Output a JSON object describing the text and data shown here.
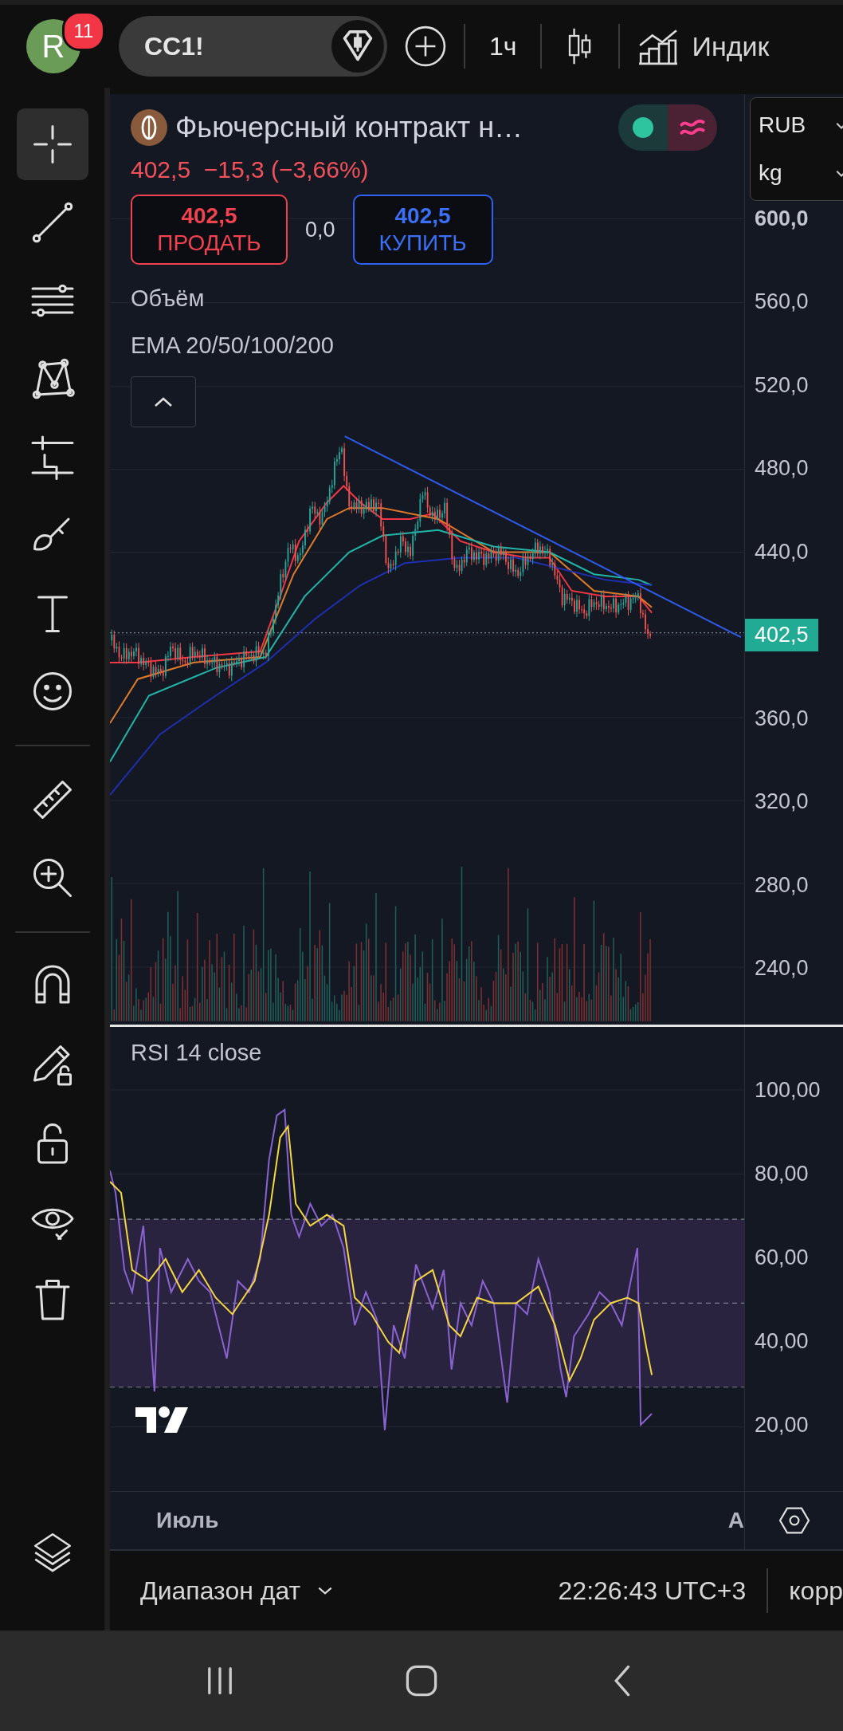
{
  "top_bar": {
    "avatar_letter": "R",
    "notification_count": "11",
    "symbol": "CC1!",
    "interval": "1ч",
    "indicators_label": "Индик"
  },
  "tool_groups": [
    {
      "tools": [
        {
          "selected": true
        },
        {
          "selected": false
        },
        {
          "selected": false
        },
        {
          "selected": false
        },
        {
          "selected": false
        },
        {
          "selected": false
        },
        {
          "selected": false
        },
        {
          "selected": false
        }
      ]
    },
    {
      "tools": [
        {
          "selected": false
        },
        {
          "selected": false
        }
      ]
    },
    {
      "tools": [
        {
          "selected": false
        },
        {
          "selected": false
        },
        {
          "selected": false
        },
        {
          "selected": false
        },
        {
          "selected": false
        }
      ]
    }
  ],
  "legend": {
    "title": "Фьючерсный контракт н…",
    "price": "402,5",
    "change": "−15,3 (−3,66%)",
    "sell": {
      "price": "402,5",
      "label": "ПРОДАТЬ"
    },
    "spread": "0,0",
    "buy": {
      "price": "402,5",
      "label": "КУПИТЬ"
    },
    "indicators": [
      "Объём",
      "EMA 20/50/100/200"
    ]
  },
  "unit_selectors": [
    "RUB",
    "kg"
  ],
  "price_axis": [
    {
      "label": "600,0",
      "kind": "tick"
    },
    {
      "label": "560,0",
      "kind": "tick"
    },
    {
      "label": "520,0",
      "kind": "tick"
    },
    {
      "label": "480,0",
      "kind": "tick"
    },
    {
      "label": "440,0",
      "kind": "tick"
    },
    {
      "label": "402,5",
      "kind": "current"
    },
    {
      "label": "360,0",
      "kind": "tick"
    },
    {
      "label": "320,0",
      "kind": "tick"
    },
    {
      "label": "280,0",
      "kind": "tick"
    },
    {
      "label": "240,0",
      "kind": "tick"
    }
  ],
  "rsi": {
    "title": "RSI 14 close",
    "axis": [
      "100,00",
      "80,00",
      "60,00",
      "40,00",
      "20,00"
    ]
  },
  "time_axis": [
    "Июль",
    "А"
  ],
  "bottom_bar": {
    "range": "Диапазон дат",
    "time": "22:26:43 UTC+3",
    "adjust": "корр"
  }
}
